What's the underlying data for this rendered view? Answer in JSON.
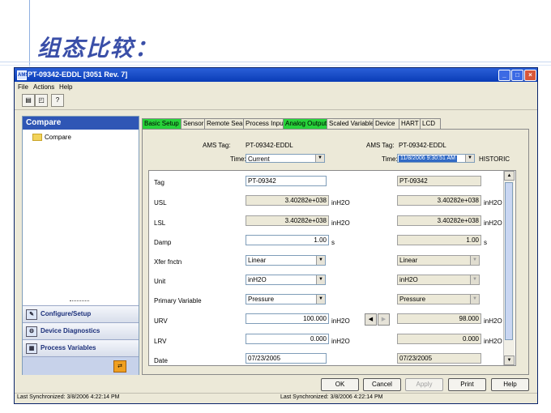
{
  "slide": {
    "title": "组态比较："
  },
  "window": {
    "title": "PT-09342-EDDL [3051 Rev. 7]",
    "app_icon": "AMS",
    "menu": [
      "File",
      "Actions",
      "Help"
    ]
  },
  "left_pane": {
    "header": "Compare",
    "tree_item": "Compare",
    "nav": [
      "Configure/Setup",
      "Device Diagnostics",
      "Process Variables"
    ]
  },
  "tabs": [
    "Basic Setup",
    "Sensor",
    "Remote Seal",
    "Process Input",
    "Analog Output",
    "Scaled Variable",
    "Device",
    "HART",
    "LCD"
  ],
  "header_left": {
    "tag_label": "AMS Tag:",
    "tag_value": "PT-09342-EDDL",
    "time_label": "Time:",
    "time_value": "Current"
  },
  "header_right": {
    "tag_label": "AMS Tag:",
    "tag_value": "PT-09342-EDDL",
    "time_label": "Time:",
    "time_value": "11/8/2006 9:30:51 AM",
    "historic": "HISTORIC"
  },
  "rows": {
    "tag": {
      "label": "Tag",
      "current": "PT-09342",
      "historic": "PT-09342"
    },
    "usl": {
      "label": "USL",
      "current": "3.40282e+038",
      "historic": "3.40282e+038",
      "unit": "inH2O"
    },
    "lsl": {
      "label": "LSL",
      "current": "3.40282e+038",
      "historic": "3.40282e+038",
      "unit": "inH2O"
    },
    "damp": {
      "label": "Damp",
      "current": "1.00",
      "historic": "1.00",
      "unit": "s"
    },
    "xfer": {
      "label": "Xfer fnctn",
      "current": "Linear",
      "historic": "Linear"
    },
    "unit": {
      "label": "Unit",
      "current": "inH2O",
      "historic": "inH2O"
    },
    "pv": {
      "label": "Primary Variable",
      "current": "Pressure",
      "historic": "Pressure"
    },
    "urv": {
      "label": "URV",
      "current": "100.000",
      "historic": "98.000",
      "unit": "inH2O"
    },
    "lrv": {
      "label": "LRV",
      "current": "0.000",
      "historic": "0.000",
      "unit": "inH2O"
    },
    "date": {
      "label": "Date",
      "current": "07/23/2005",
      "historic": "07/23/2005"
    }
  },
  "buttons": {
    "ok": "OK",
    "cancel": "Cancel",
    "apply": "Apply",
    "print": "Print",
    "help": "Help"
  },
  "status": {
    "left": "Last Synchronized: 3/8/2006 4:22:14 PM",
    "right": "Last Synchronized: 3/8/2006 4:22:14 PM"
  },
  "colors": {
    "tab_highlight": "#27d33a",
    "title_bar": "#0a3cb6",
    "slide_title": "#3a4fa8"
  }
}
